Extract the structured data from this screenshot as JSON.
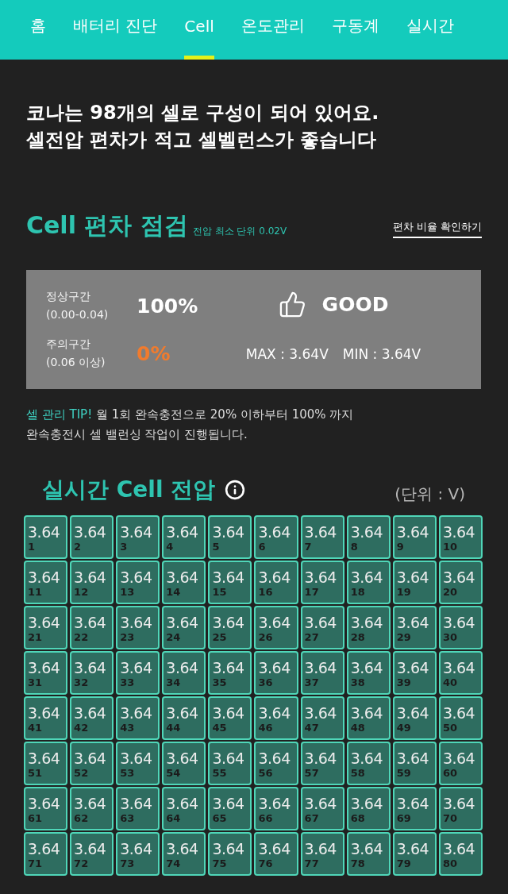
{
  "nav": {
    "tabs": [
      {
        "label": "홈",
        "selected": false
      },
      {
        "label": "배터리 진단",
        "selected": false
      },
      {
        "label": "Cell",
        "selected": true
      },
      {
        "label": "온도관리",
        "selected": false
      },
      {
        "label": "구동계",
        "selected": false
      },
      {
        "label": "실시간",
        "selected": false
      }
    ]
  },
  "intro": {
    "lines": [
      "코나는 98개의 셀로 구성이 되어 있어요.",
      "셀전압 편차가 적고 셀벨런스가 좋습니다"
    ]
  },
  "deviation_check": {
    "title": "Cell 편차 점검",
    "subtitle": "전압 최소 단위 0.02V",
    "link": "편차 비율 확인하기",
    "zones": [
      {
        "kind": "normal",
        "name": "정상구간",
        "range": "(0.00-0.04)",
        "percent": "100%"
      },
      {
        "kind": "warning",
        "name": "주의구간",
        "range": "(0.06 이상)",
        "percent": "0%"
      }
    ],
    "verdict": "GOOD",
    "max": "MAX : 3.64V",
    "min": "MIN : 3.64V"
  },
  "tip": {
    "label": "셀 관리 TIP!",
    "text": "월 1회 완속충전으로 20% 이하부터 100% 까지 완속충전시 셀 밸런싱 작업이 진행됩니다."
  },
  "cell_voltages": {
    "title": "실시간 Cell 전압",
    "unit": "(단위 : V)",
    "cells": [
      {
        "value": "3.64",
        "number": "1"
      },
      {
        "value": "3.64",
        "number": "2"
      },
      {
        "value": "3.64",
        "number": "3"
      },
      {
        "value": "3.64",
        "number": "4"
      },
      {
        "value": "3.64",
        "number": "5"
      },
      {
        "value": "3.64",
        "number": "6"
      },
      {
        "value": "3.64",
        "number": "7"
      },
      {
        "value": "3.64",
        "number": "8"
      },
      {
        "value": "3.64",
        "number": "9"
      },
      {
        "value": "3.64",
        "number": "10"
      },
      {
        "value": "3.64",
        "number": "11"
      },
      {
        "value": "3.64",
        "number": "12"
      },
      {
        "value": "3.64",
        "number": "13"
      },
      {
        "value": "3.64",
        "number": "14"
      },
      {
        "value": "3.64",
        "number": "15"
      },
      {
        "value": "3.64",
        "number": "16"
      },
      {
        "value": "3.64",
        "number": "17"
      },
      {
        "value": "3.64",
        "number": "18"
      },
      {
        "value": "3.64",
        "number": "19"
      },
      {
        "value": "3.64",
        "number": "20"
      },
      {
        "value": "3.64",
        "number": "21"
      },
      {
        "value": "3.64",
        "number": "22"
      },
      {
        "value": "3.64",
        "number": "23"
      },
      {
        "value": "3.64",
        "number": "24"
      },
      {
        "value": "3.64",
        "number": "25"
      },
      {
        "value": "3.64",
        "number": "26"
      },
      {
        "value": "3.64",
        "number": "27"
      },
      {
        "value": "3.64",
        "number": "28"
      },
      {
        "value": "3.64",
        "number": "29"
      },
      {
        "value": "3.64",
        "number": "30"
      },
      {
        "value": "3.64",
        "number": "31"
      },
      {
        "value": "3.64",
        "number": "32"
      },
      {
        "value": "3.64",
        "number": "33"
      },
      {
        "value": "3.64",
        "number": "34"
      },
      {
        "value": "3.64",
        "number": "35"
      },
      {
        "value": "3.64",
        "number": "36"
      },
      {
        "value": "3.64",
        "number": "37"
      },
      {
        "value": "3.64",
        "number": "38"
      },
      {
        "value": "3.64",
        "number": "39"
      },
      {
        "value": "3.64",
        "number": "40"
      },
      {
        "value": "3.64",
        "number": "41"
      },
      {
        "value": "3.64",
        "number": "42"
      },
      {
        "value": "3.64",
        "number": "43"
      },
      {
        "value": "3.64",
        "number": "44"
      },
      {
        "value": "3.64",
        "number": "45"
      },
      {
        "value": "3.64",
        "number": "46"
      },
      {
        "value": "3.64",
        "number": "47"
      },
      {
        "value": "3.64",
        "number": "48"
      },
      {
        "value": "3.64",
        "number": "49"
      },
      {
        "value": "3.64",
        "number": "50"
      },
      {
        "value": "3.64",
        "number": "51"
      },
      {
        "value": "3.64",
        "number": "52"
      },
      {
        "value": "3.64",
        "number": "53"
      },
      {
        "value": "3.64",
        "number": "54"
      },
      {
        "value": "3.64",
        "number": "55"
      },
      {
        "value": "3.64",
        "number": "56"
      },
      {
        "value": "3.64",
        "number": "57"
      },
      {
        "value": "3.64",
        "number": "58"
      },
      {
        "value": "3.64",
        "number": "59"
      },
      {
        "value": "3.64",
        "number": "60"
      },
      {
        "value": "3.64",
        "number": "61"
      },
      {
        "value": "3.64",
        "number": "62"
      },
      {
        "value": "3.64",
        "number": "63"
      },
      {
        "value": "3.64",
        "number": "64"
      },
      {
        "value": "3.64",
        "number": "65"
      },
      {
        "value": "3.64",
        "number": "66"
      },
      {
        "value": "3.64",
        "number": "67"
      },
      {
        "value": "3.64",
        "number": "68"
      },
      {
        "value": "3.64",
        "number": "69"
      },
      {
        "value": "3.64",
        "number": "70"
      },
      {
        "value": "3.64",
        "number": "71"
      },
      {
        "value": "3.64",
        "number": "72"
      },
      {
        "value": "3.64",
        "number": "73"
      },
      {
        "value": "3.64",
        "number": "74"
      },
      {
        "value": "3.64",
        "number": "75"
      },
      {
        "value": "3.64",
        "number": "76"
      },
      {
        "value": "3.64",
        "number": "77"
      },
      {
        "value": "3.64",
        "number": "78"
      },
      {
        "value": "3.64",
        "number": "79"
      },
      {
        "value": "3.64",
        "number": "80"
      }
    ]
  }
}
